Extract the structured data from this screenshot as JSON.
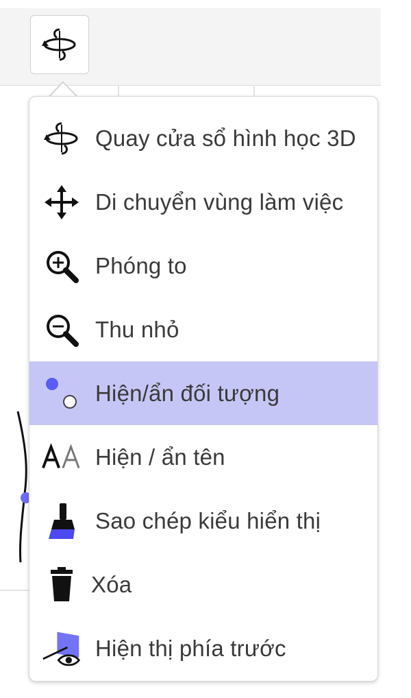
{
  "menu": {
    "items": [
      {
        "label": "Quay cửa sổ hình học 3D",
        "icon": "rotate-3d-icon"
      },
      {
        "label": "Di chuyển vùng làm việc",
        "icon": "move-arrows-icon"
      },
      {
        "label": "Phóng to",
        "icon": "zoom-in-icon"
      },
      {
        "label": "Thu nhỏ",
        "icon": "zoom-out-icon"
      },
      {
        "label": "Hiện/ẩn đối tượng",
        "icon": "show-hide-object-icon",
        "selected": true
      },
      {
        "label": "Hiện / ẩn tên",
        "icon": "show-hide-label-icon"
      },
      {
        "label": "Sao chép kiểu hiển thị",
        "icon": "copy-style-brush-icon"
      },
      {
        "label": "Xóa",
        "icon": "trash-icon"
      },
      {
        "label": "Hiện thị phía trước",
        "icon": "view-in-front-icon"
      }
    ]
  },
  "colors": {
    "selected_background": "#c6c6f6",
    "accent": "#5b5bf5",
    "text": "#3a3a3a"
  }
}
